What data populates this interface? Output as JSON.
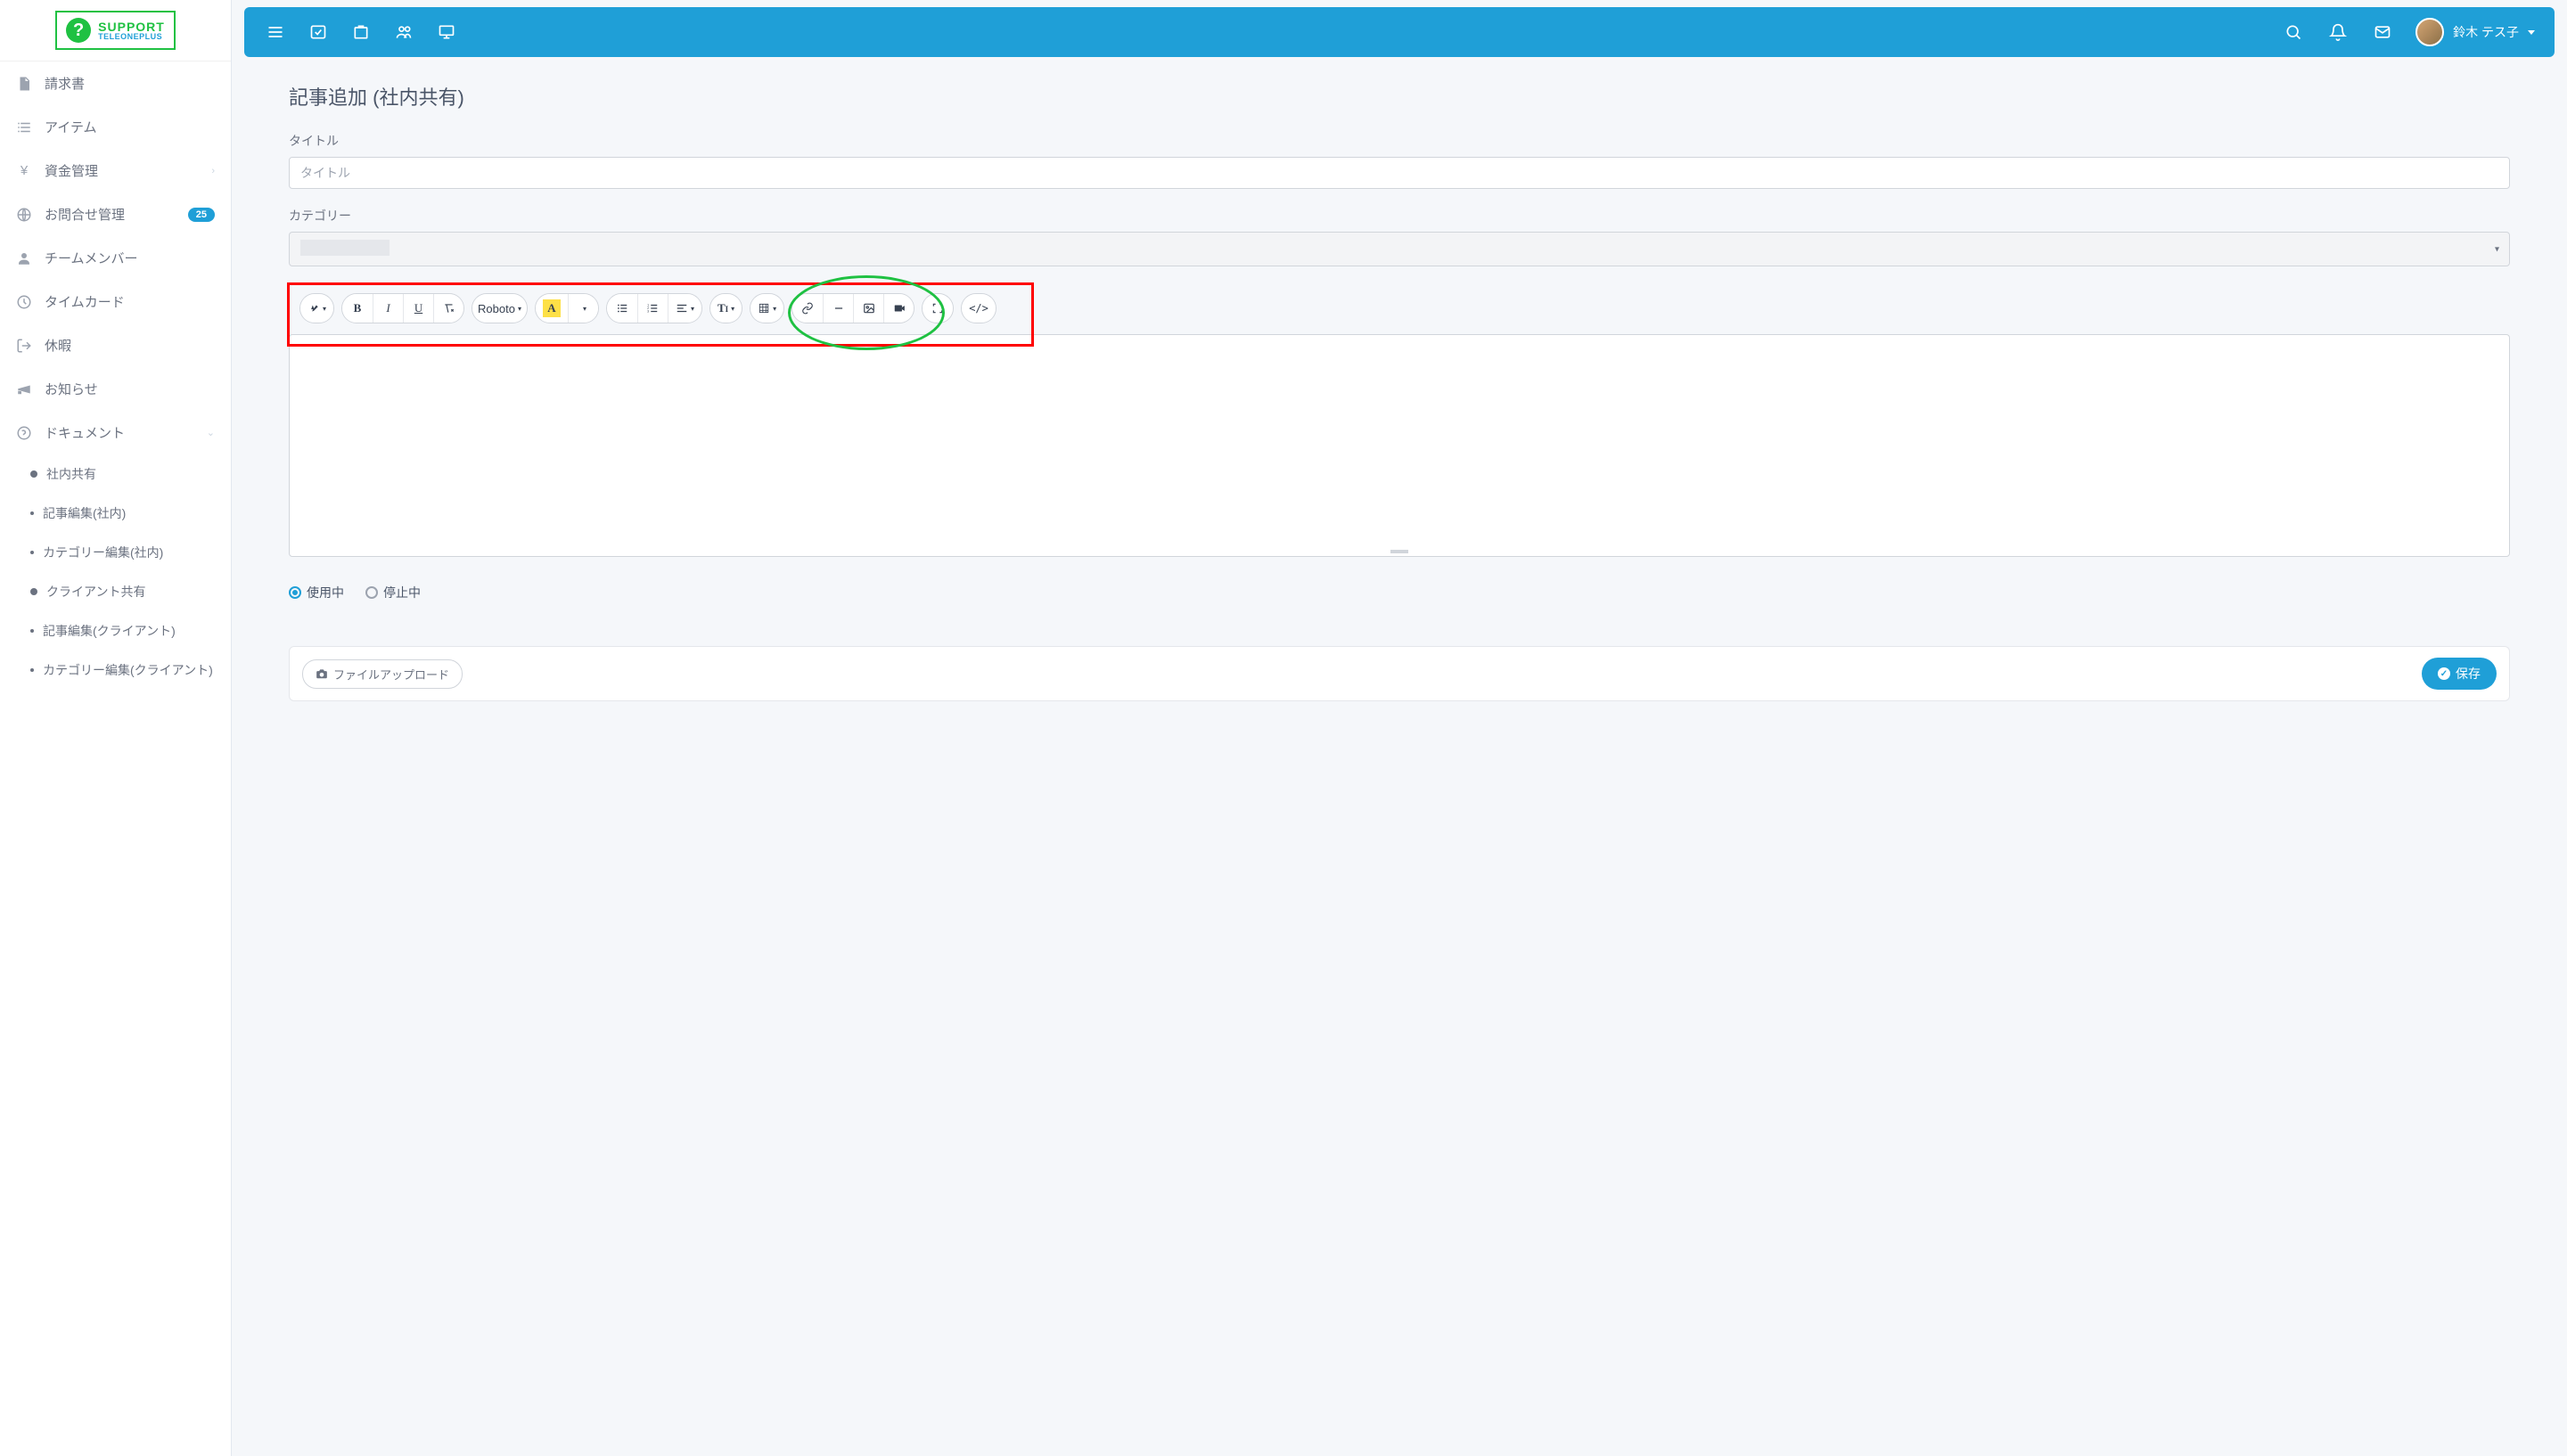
{
  "logo": {
    "main": "SUPPORT",
    "sub": "TELEONEPLUS"
  },
  "sidebar": {
    "items": [
      {
        "label": "請求書"
      },
      {
        "label": "アイテム"
      },
      {
        "label": "資金管理",
        "expandable": true
      },
      {
        "label": "お問合せ管理",
        "badge": "25"
      },
      {
        "label": "チームメンバー"
      },
      {
        "label": "タイムカード"
      },
      {
        "label": "休暇"
      },
      {
        "label": "お知らせ"
      },
      {
        "label": "ドキュメント",
        "expandable": true
      }
    ],
    "docs_sub": [
      {
        "label": "社内共有",
        "solid": true
      },
      {
        "label": "記事編集(社内)"
      },
      {
        "label": "カテゴリー編集(社内)"
      },
      {
        "label": "クライアント共有",
        "solid": true
      },
      {
        "label": "記事編集(クライアント)"
      },
      {
        "label": "カテゴリー編集(クライアント)"
      }
    ]
  },
  "user": {
    "name": "鈴木 テス子"
  },
  "page": {
    "title": "記事追加 (社内共有)",
    "title_label": "タイトル",
    "title_placeholder": "タイトル",
    "category_label": "カテゴリー",
    "radio_active": "使用中",
    "radio_inactive": "停止中",
    "upload": "ファイルアップロード",
    "save": "保存"
  },
  "toolbar": {
    "font": "Roboto"
  }
}
